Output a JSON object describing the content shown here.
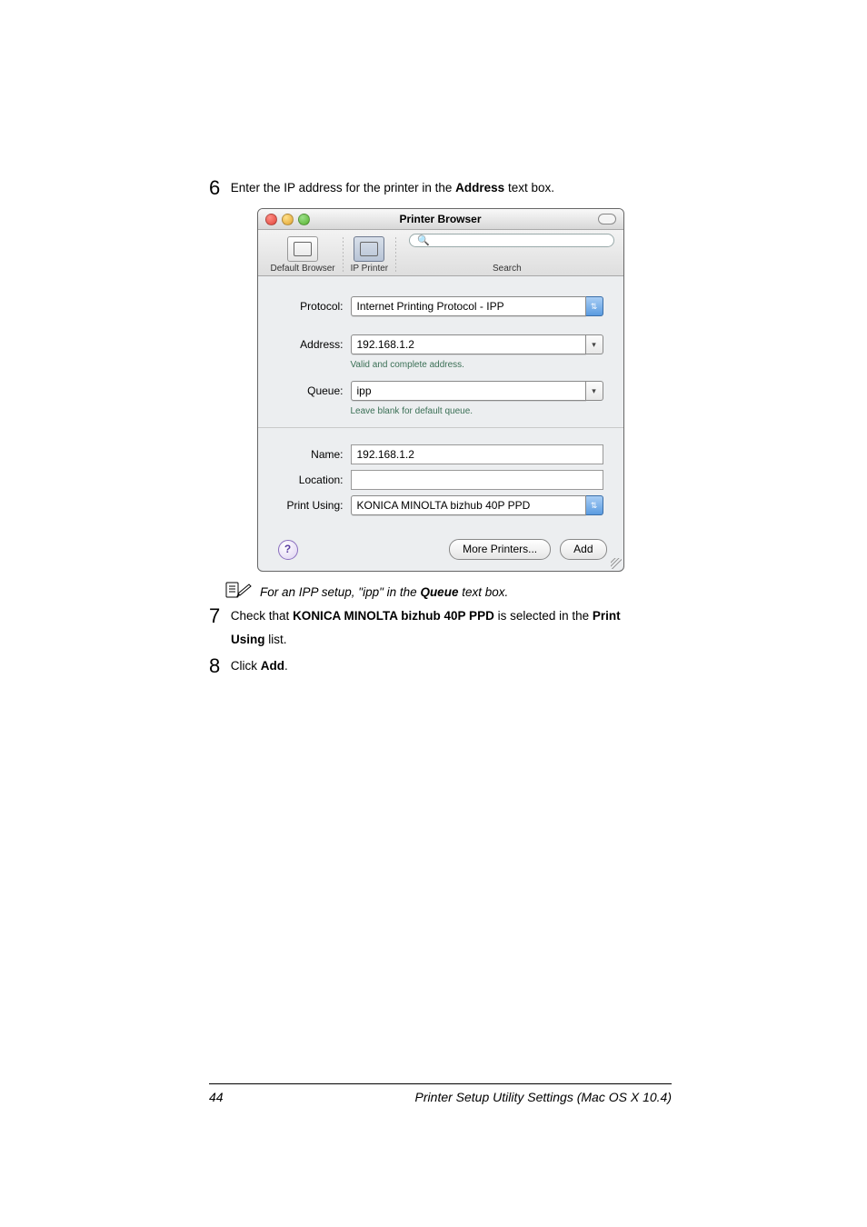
{
  "step6": {
    "num": "6",
    "pre": "Enter the IP address for the printer in the ",
    "bold": "Address",
    "post": " text box."
  },
  "note": {
    "pre": "For an IPP setup, \"ipp\" in the ",
    "bold": "Queue",
    "post": " text box."
  },
  "step7": {
    "num": "7",
    "pre": "Check that ",
    "bold1": "KONICA MINOLTA bizhub 40P PPD",
    "mid": " is selected in the ",
    "bold2": "Print",
    "cont_bold": "Using",
    "cont_post": " list."
  },
  "step8": {
    "num": "8",
    "pre": "Click ",
    "bold": "Add",
    "post": "."
  },
  "dialog": {
    "title": "Printer Browser",
    "tabs": {
      "default": "Default Browser",
      "ip": "IP Printer",
      "search": "Search"
    },
    "search_placeholder": "Q",
    "protocol": {
      "label": "Protocol:",
      "value": "Internet Printing Protocol - IPP"
    },
    "address": {
      "label": "Address:",
      "value": "192.168.1.2",
      "hint": "Valid and complete address."
    },
    "queue": {
      "label": "Queue:",
      "value": "ipp",
      "hint": "Leave blank for default queue."
    },
    "name": {
      "label": "Name:",
      "value": "192.168.1.2"
    },
    "location": {
      "label": "Location:",
      "value": ""
    },
    "print_using": {
      "label": "Print Using:",
      "value": "KONICA MINOLTA bizhub 40P PPD"
    },
    "buttons": {
      "more": "More Printers...",
      "add": "Add",
      "help": "?"
    }
  },
  "footer": {
    "page": "44",
    "title": "Printer Setup Utility Settings (Mac OS X 10.4)"
  }
}
